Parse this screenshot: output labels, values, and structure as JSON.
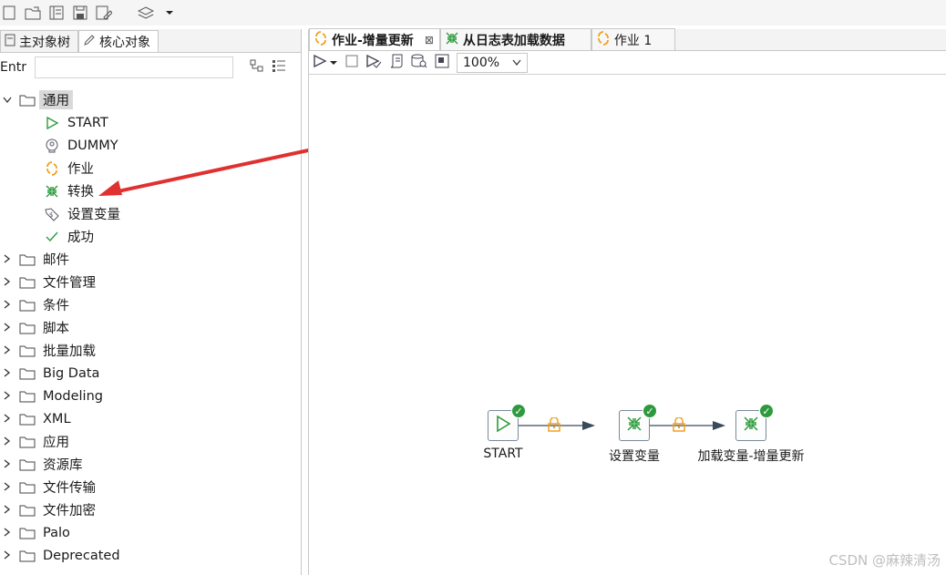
{
  "left_tabs": [
    {
      "label": "主对象树",
      "active": false
    },
    {
      "label": "核心对象",
      "active": true
    }
  ],
  "search": {
    "label": "Entr",
    "value": ""
  },
  "tree": {
    "open_folder": "通用",
    "children": [
      "START",
      "DUMMY",
      "作业",
      "转换",
      "设置变量",
      "成功"
    ],
    "folders": [
      "邮件",
      "文件管理",
      "条件",
      "脚本",
      "批量加载",
      "Big Data",
      "Modeling",
      "XML",
      "应用",
      "资源库",
      "文件传输",
      "文件加密",
      "Palo",
      "Deprecated"
    ]
  },
  "editor_tabs": [
    {
      "label": "作业-增量更新",
      "active": true,
      "closable": true
    },
    {
      "label": "从日志表加载数据",
      "active": false,
      "closable": false
    },
    {
      "label": "作业 1",
      "active": false,
      "closable": false
    }
  ],
  "zoom": "100%",
  "nodes": [
    {
      "label": "START"
    },
    {
      "label": "设置变量"
    },
    {
      "label": "加载变量-增量更新"
    }
  ],
  "watermark": "CSDN @麻辣清汤",
  "colors": {
    "accent_green": "#2d9b3d",
    "arrow_red": "#e03030",
    "job_orange": "#f0a020",
    "lock_orange": "#f0a020",
    "hop": "#3a4a5a"
  }
}
